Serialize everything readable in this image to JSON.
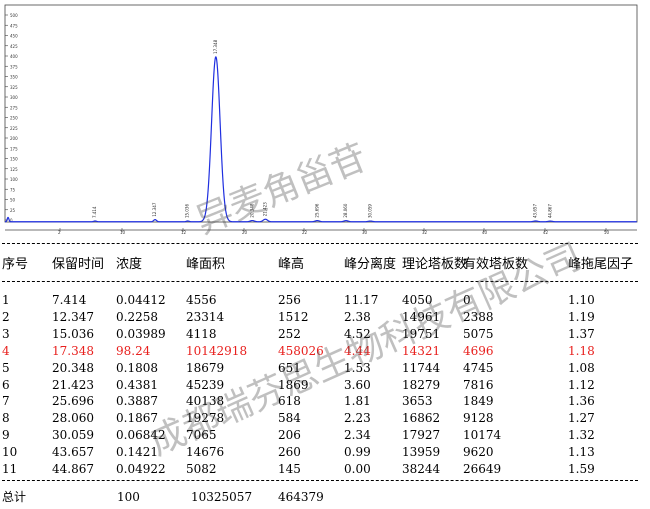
{
  "chart_data": {
    "type": "line",
    "x_tick_labels": [
      "2",
      "10",
      "12",
      "20",
      "22",
      "30",
      "32",
      "40",
      "42",
      "50"
    ],
    "y_tick_labels": [
      "500",
      "475",
      "450",
      "425",
      "400",
      "375",
      "350",
      "325",
      "300",
      "275",
      "250",
      "225",
      "200",
      "175",
      "150",
      "125",
      "100",
      "75",
      "50",
      "25",
      "0"
    ],
    "peaks": [
      {
        "rt": 7.414,
        "height": 256,
        "label": "7.414"
      },
      {
        "rt": 12.347,
        "height": 1512,
        "label": "12.347"
      },
      {
        "rt": 15.036,
        "height": 252,
        "label": "15.036"
      },
      {
        "rt": 17.348,
        "height": 458026,
        "label": "17.348"
      },
      {
        "rt": 20.348,
        "height": 651,
        "label": "20.348"
      },
      {
        "rt": 21.423,
        "height": 1869,
        "label": "21.423"
      },
      {
        "rt": 25.696,
        "height": 618,
        "label": "25.696"
      },
      {
        "rt": 28.06,
        "height": 584,
        "label": "28.060"
      },
      {
        "rt": 30.059,
        "height": 206,
        "label": "30.059"
      },
      {
        "rt": 43.657,
        "height": 260,
        "label": "43.657"
      },
      {
        "rt": 44.867,
        "height": 145,
        "label": "44.867"
      }
    ],
    "xlim": [
      0,
      52
    ],
    "ylim": [
      0,
      500
    ],
    "line_color": "#1f2fe0"
  },
  "table": {
    "headers": [
      "序号",
      "保留时间",
      "浓度",
      "峰面积",
      "峰高",
      "峰分离度",
      "理论塔板数",
      "有效塔板数",
      "峰拖尾因子"
    ],
    "rows": [
      [
        "1",
        "7.414",
        "0.04412",
        "4556",
        "256",
        "11.17",
        "4050",
        "0",
        "1.10"
      ],
      [
        "2",
        "12.347",
        "0.2258",
        "23314",
        "1512",
        "2.38",
        "14961",
        "2388",
        "1.19"
      ],
      [
        "3",
        "15.036",
        "0.03989",
        "4118",
        "252",
        "4.52",
        "19751",
        "5075",
        "1.37"
      ],
      [
        "4",
        "17.348",
        "98.24",
        "10142918",
        "458026",
        "4.44",
        "14321",
        "4696",
        "1.18"
      ],
      [
        "5",
        "20.348",
        "0.1808",
        "18679",
        "651",
        "1.53",
        "11744",
        "4745",
        "1.08"
      ],
      [
        "6",
        "21.423",
        "0.4381",
        "45239",
        "1869",
        "3.60",
        "18279",
        "7816",
        "1.12"
      ],
      [
        "7",
        "25.696",
        "0.3887",
        "40138",
        "618",
        "1.81",
        "3653",
        "1849",
        "1.36"
      ],
      [
        "8",
        "28.060",
        "0.1867",
        "19278",
        "584",
        "2.23",
        "16862",
        "9128",
        "1.27"
      ],
      [
        "9",
        "30.059",
        "0.06842",
        "7065",
        "206",
        "2.34",
        "17927",
        "10174",
        "1.32"
      ],
      [
        "10",
        "43.657",
        "0.1421",
        "14676",
        "260",
        "0.99",
        "13959",
        "9620",
        "1.13"
      ],
      [
        "11",
        "44.867",
        "0.04922",
        "5082",
        "145",
        "0.00",
        "38244",
        "26649",
        "1.59"
      ]
    ],
    "highlight_row": 3,
    "highlight_color": "#e8201e",
    "total_label": "总计",
    "total_concentration": "100",
    "total_area": "10325057",
    "total_height": "464379"
  },
  "watermarks": [
    "异麦角甾苷",
    "成都瑞芬思生物科技有限公司"
  ]
}
